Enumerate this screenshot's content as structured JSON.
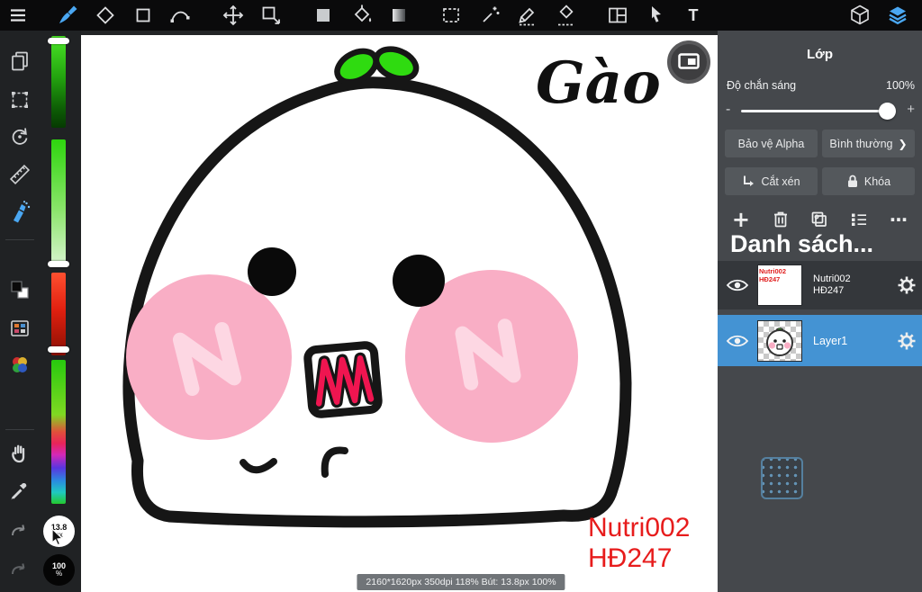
{
  "toolbar": {
    "text_tool": "T"
  },
  "sidebar": {
    "brush_size": {
      "value": "13.8",
      "unit": "px"
    },
    "zoom": {
      "value": "100",
      "unit": "%"
    }
  },
  "canvas": {
    "signature": "Gào",
    "cheek_letter": "N",
    "watermark": [
      "Nutri002",
      "HĐ247"
    ],
    "status": "2160*1620px 350dpi 118% Bút: 13.8px 100%"
  },
  "layer_panel": {
    "title": "Lớp",
    "opacity": {
      "label": "Độ chắn sáng",
      "value": "100%",
      "minus": "-",
      "plus": "+"
    },
    "buttons": {
      "protect_alpha": "Bảo vệ Alpha",
      "blend_mode": "Bình thường",
      "clipping": "Cắt xén",
      "lock": "Khóa"
    },
    "list_title": "Danh sách...",
    "layers": [
      {
        "name_line1": "Nutri002",
        "name_line2": "HĐ247",
        "thumb_line1": "Nutri002",
        "thumb_line2": "HĐ247",
        "selected": false
      },
      {
        "name": "Layer1",
        "selected": true
      }
    ]
  },
  "glyphs": {
    "add": "+",
    "more": "⋯",
    "chevron": "❯"
  },
  "colors": {
    "accent_blue": "#4aa7f2",
    "selected_layer_blue": "#4493d3",
    "cheek_pink": "#f9aec5",
    "cheek_letter_pink": "#fdd7e3",
    "sprout_green": "#2fdb10",
    "watermark_red": "#e71c1c",
    "mouth_red": "#ef1550"
  }
}
